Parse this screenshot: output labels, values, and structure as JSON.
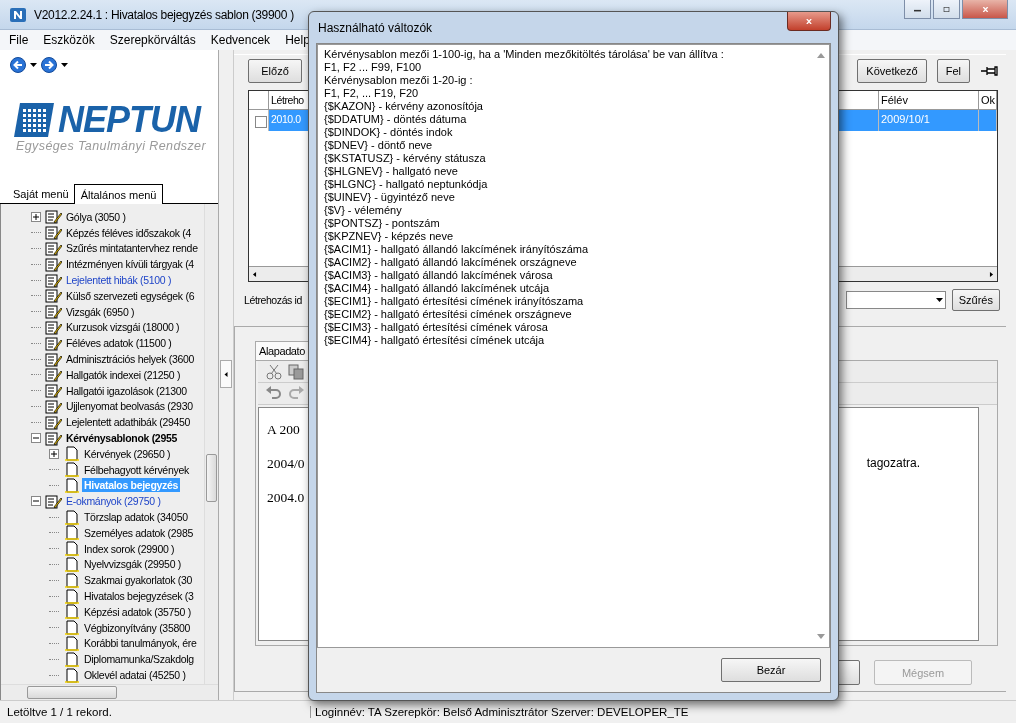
{
  "window": {
    "title": "V2012.2.24.1 : Hivatalos bejegyzés sablon (39900 )"
  },
  "menu": [
    "File",
    "Eszközök",
    "Szerepkörváltás",
    "Kedvencek",
    "Help"
  ],
  "logo": {
    "name": "NEPTUN",
    "tagline": "Egységes Tanulmányi Rendszer"
  },
  "sidebar": {
    "tabs": [
      {
        "label": "Saját menü",
        "selected": false
      },
      {
        "label": "Általános menü",
        "selected": true
      }
    ],
    "tree": [
      {
        "label": "Gólya (3050 )",
        "expanded": false,
        "selected": false,
        "marked": false,
        "current": false
      },
      {
        "label": "Képzés féléves időszakok (4",
        "selected": false,
        "marked": false,
        "current": false
      },
      {
        "label": "Szűrés mintatantervhez rende",
        "selected": false,
        "marked": false,
        "current": false
      },
      {
        "label": "Intézményen kívüli tárgyak (4",
        "selected": false,
        "marked": false,
        "current": false
      },
      {
        "label": "Lejelentett hibák (5100 )",
        "selected": false,
        "marked": true,
        "current": false
      },
      {
        "label": "Külső szervezeti egységek (6",
        "selected": false,
        "marked": false,
        "current": false
      },
      {
        "label": "Vizsgák (6950 )",
        "selected": false,
        "marked": false,
        "current": false
      },
      {
        "label": "Kurzusok vizsgái (18000 )",
        "selected": false,
        "marked": false,
        "current": false
      },
      {
        "label": "Féléves adatok (11500 )",
        "selected": false,
        "marked": false,
        "current": false
      },
      {
        "label": "Adminisztrációs helyek (3600",
        "selected": false,
        "marked": false,
        "current": false
      },
      {
        "label": "Hallgatók indexei (21250 )",
        "selected": false,
        "marked": false,
        "current": false
      },
      {
        "label": "Hallgatói igazolások (21300",
        "selected": false,
        "marked": false,
        "current": false
      },
      {
        "label": "Ujjlenyomat beolvasás (2930",
        "selected": false,
        "marked": false,
        "current": false
      },
      {
        "label": "Lejelentett adathibák (29450",
        "selected": false,
        "marked": false,
        "current": false
      },
      {
        "label": "Kérvénysablonok (2955",
        "expanded": true,
        "selected": false,
        "marked": false,
        "current": true,
        "children": [
          {
            "label": "Kérvények (29650 )",
            "expanded": false,
            "selected": false,
            "marked": false,
            "current": false
          },
          {
            "label": "Félbehagyott kérvények",
            "selected": false,
            "marked": false,
            "current": false
          },
          {
            "label": "Hivatalos bejegyzés",
            "selected": true,
            "marked": false,
            "current": false
          }
        ]
      },
      {
        "label": "E-okmányok (29750 )",
        "expanded": true,
        "selected": false,
        "marked": true,
        "current": false,
        "children": [
          {
            "label": "Törzslap adatok (34050",
            "selected": false,
            "marked": false,
            "current": false
          },
          {
            "label": "Személyes adatok (2985",
            "selected": false,
            "marked": false,
            "current": false
          },
          {
            "label": "Index sorok (29900 )",
            "selected": false,
            "marked": false,
            "current": false
          },
          {
            "label": "Nyelvvizsgák (29950 )",
            "selected": false,
            "marked": false,
            "current": false
          },
          {
            "label": "Szakmai gyakorlatok (30",
            "selected": false,
            "marked": false,
            "current": false
          },
          {
            "label": "Hivatalos bejegyzések (3",
            "selected": false,
            "marked": false,
            "current": false
          },
          {
            "label": "Képzési adatok (35750 )",
            "selected": false,
            "marked": false,
            "current": false
          },
          {
            "label": "Végbizonyítvány (35800",
            "selected": false,
            "marked": false,
            "current": false
          },
          {
            "label": "Korábbi tanulmányok, ére",
            "selected": false,
            "marked": false,
            "current": false
          },
          {
            "label": "Diplomamunka/Szakdolg",
            "selected": false,
            "marked": false,
            "current": false
          },
          {
            "label": "Oklevél adatai (45250 )",
            "selected": false,
            "marked": false,
            "current": false
          }
        ]
      }
    ]
  },
  "toolbar": {
    "previous": "Előző",
    "next": "Következő",
    "up": "Fel"
  },
  "table": {
    "columns": [
      "Létreho",
      "Félév",
      "Ok"
    ],
    "rows": [
      {
        "selected": true,
        "checked": false,
        "cells": [
          "2010.0",
          "2009/10/1"
        ]
      }
    ]
  },
  "filter": {
    "label": "Létrehozás id",
    "button": "Szűrés"
  },
  "details": {
    "tab": "Alapadato",
    "lines": [
      {
        "start": "A 200"
      },
      {
        "start": "2004/0",
        "end": "tagozatra."
      },
      {
        "start": "2004.0"
      }
    ]
  },
  "cancel_button": {
    "label": "Mégsem",
    "disabled": true
  },
  "status_bar": {
    "message": "Letöltve 1 / 1 rekord.",
    "login": "Loginnév: TA   Szerepkör: Belső Adminisztrátor   Szerver: DEVELOPER_TE"
  },
  "dialog": {
    "title": "Használható változók",
    "close_button": "Bezár",
    "lines": [
      "Kérvénysablon mezői 1-100-ig, ha a 'Minden mezőkitöltés tárolása' be van állítva :",
      "F1, F2 ... F99, F100",
      "Kérvénysablon mezői 1-20-ig :",
      "F1, F2, ... F19, F20",
      "{$KAZON} - kérvény azonosítója",
      "{$DDATUM} - döntés dátuma",
      "{$DINDOK} - döntés indok",
      "{$DNEV} - döntő neve",
      "{$KSTATUSZ} - kérvény státusza",
      "{$HLGNEV} - hallgató neve",
      "{$HLGNC} - hallgató neptunkódja",
      "{$UINEV} - ügyintéző neve",
      "{$V} - vélemény",
      "{$PONTSZ} - pontszám",
      "{$KPZNEV} - képzés neve",
      "{$ACIM1} - hallgató állandó lakcímének irányítószáma",
      "{$ACIM2} - hallgató állandó lakcímének országneve",
      "{$ACIM3} - hallgató állandó lakcímének városa",
      "{$ACIM4} - hallgató állandó lakcímének utcája",
      "{$ECIM1} - hallgató értesítési címének irányítószama",
      "{$ECIM2} - hallgató értesítési címének országneve",
      "{$ECIM3} - hallgató értesítési címének városa",
      "{$ECIM4} - hallgató értesítési címének utcája"
    ]
  }
}
